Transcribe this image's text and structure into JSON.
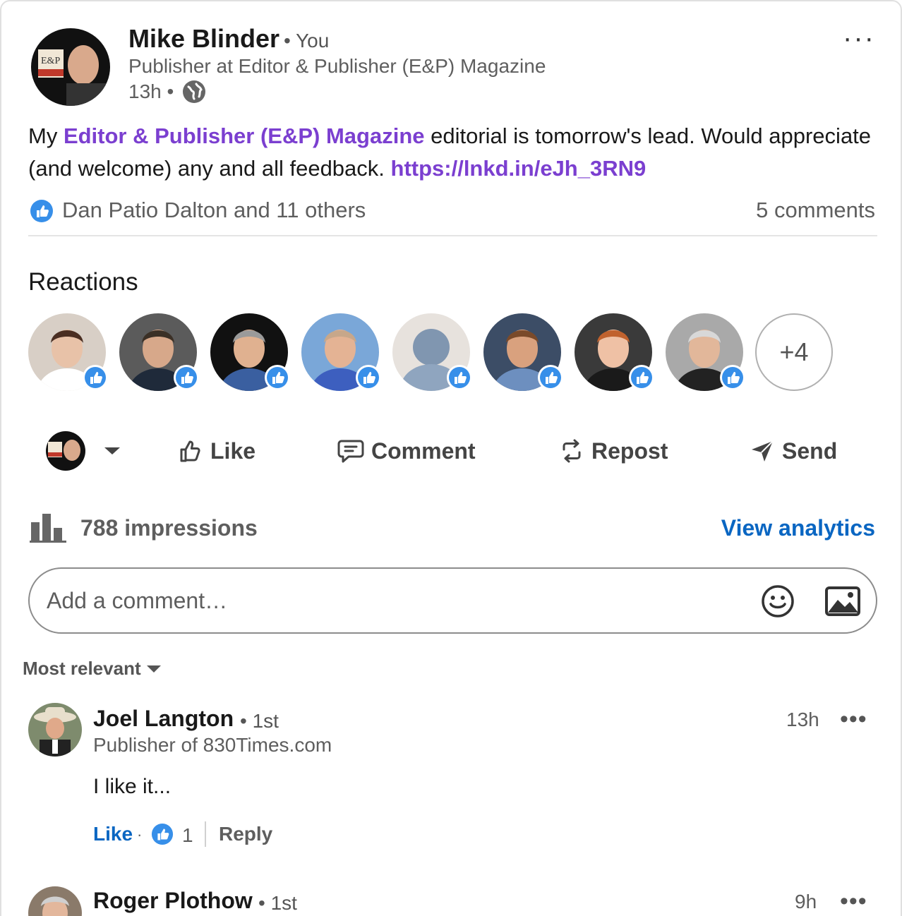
{
  "post": {
    "author_name": "Mike Blinder",
    "author_degree": "• You",
    "author_title": "Publisher at Editor & Publisher (E&P) Magazine",
    "time": "13h •",
    "more": "···",
    "text_prefix": "My ",
    "mention": "Editor & Publisher (E&P) Magazine",
    "text_middle": " editorial is tomorrow's lead. Would appreciate (and welcome) any and all feedback. ",
    "link": "https://lnkd.in/eJh_3RN9",
    "likes_text": "Dan Patio Dalton and 11 others",
    "comments_count": "5 comments"
  },
  "reactions": {
    "title": "Reactions",
    "more_label": "+4",
    "people": [
      {
        "name": "reactor-1",
        "bg": "#d8cfc6",
        "skin": "#e8c2a8",
        "hair": "#4a2e22",
        "shirt": "#ffffff"
      },
      {
        "name": "reactor-2",
        "bg": "#5b5b5b",
        "skin": "#d7a88a",
        "hair": "#3b3026",
        "shirt": "#1f2a3a"
      },
      {
        "name": "reactor-3",
        "bg": "#111111",
        "skin": "#e0b190",
        "hair": "#9a9a9a",
        "shirt": "#3a5fa0"
      },
      {
        "name": "reactor-4",
        "bg": "#7aa7d8",
        "skin": "#e4b394",
        "hair": "#c7a78a",
        "shirt": "#3d5fbf"
      },
      {
        "name": "reactor-5",
        "bg": "#e7e2dd",
        "skin": "#8096b0",
        "hair": "#8096b0",
        "shirt": "#8fa5bf"
      },
      {
        "name": "reactor-6",
        "bg": "#3c4d66",
        "skin": "#d9a17e",
        "hair": "#7a4a2a",
        "shirt": "#6d8fbf"
      },
      {
        "name": "reactor-7",
        "bg": "#3a3a3a",
        "skin": "#efc1a5",
        "hair": "#c0622e",
        "shirt": "#1a1a1a"
      },
      {
        "name": "reactor-8",
        "bg": "#a9a9a9",
        "skin": "#e2b79a",
        "hair": "#d8d8d8",
        "shirt": "#222222"
      }
    ]
  },
  "actions": {
    "like": "Like",
    "comment": "Comment",
    "repost": "Repost",
    "send": "Send"
  },
  "stats": {
    "impressions": "788 impressions",
    "analytics": "View analytics"
  },
  "comment_box": {
    "placeholder": "Add a comment…"
  },
  "sort": {
    "label": "Most relevant"
  },
  "comments": [
    {
      "name": "Joel Langton",
      "degree": "• 1st",
      "headline": "Publisher of 830Times.com",
      "time": "13h",
      "more": "•••",
      "body": "I like it...",
      "like_label": "Like",
      "dot": "·",
      "like_count": "1",
      "reply_label": "Reply"
    },
    {
      "name": "Roger Plothow",
      "degree": "• 1st",
      "time": "9h",
      "more": "•••"
    }
  ],
  "colors": {
    "accent_blue": "#0a66c2",
    "mention_purple": "#7b3fd0",
    "like_blue": "#378fe9"
  }
}
